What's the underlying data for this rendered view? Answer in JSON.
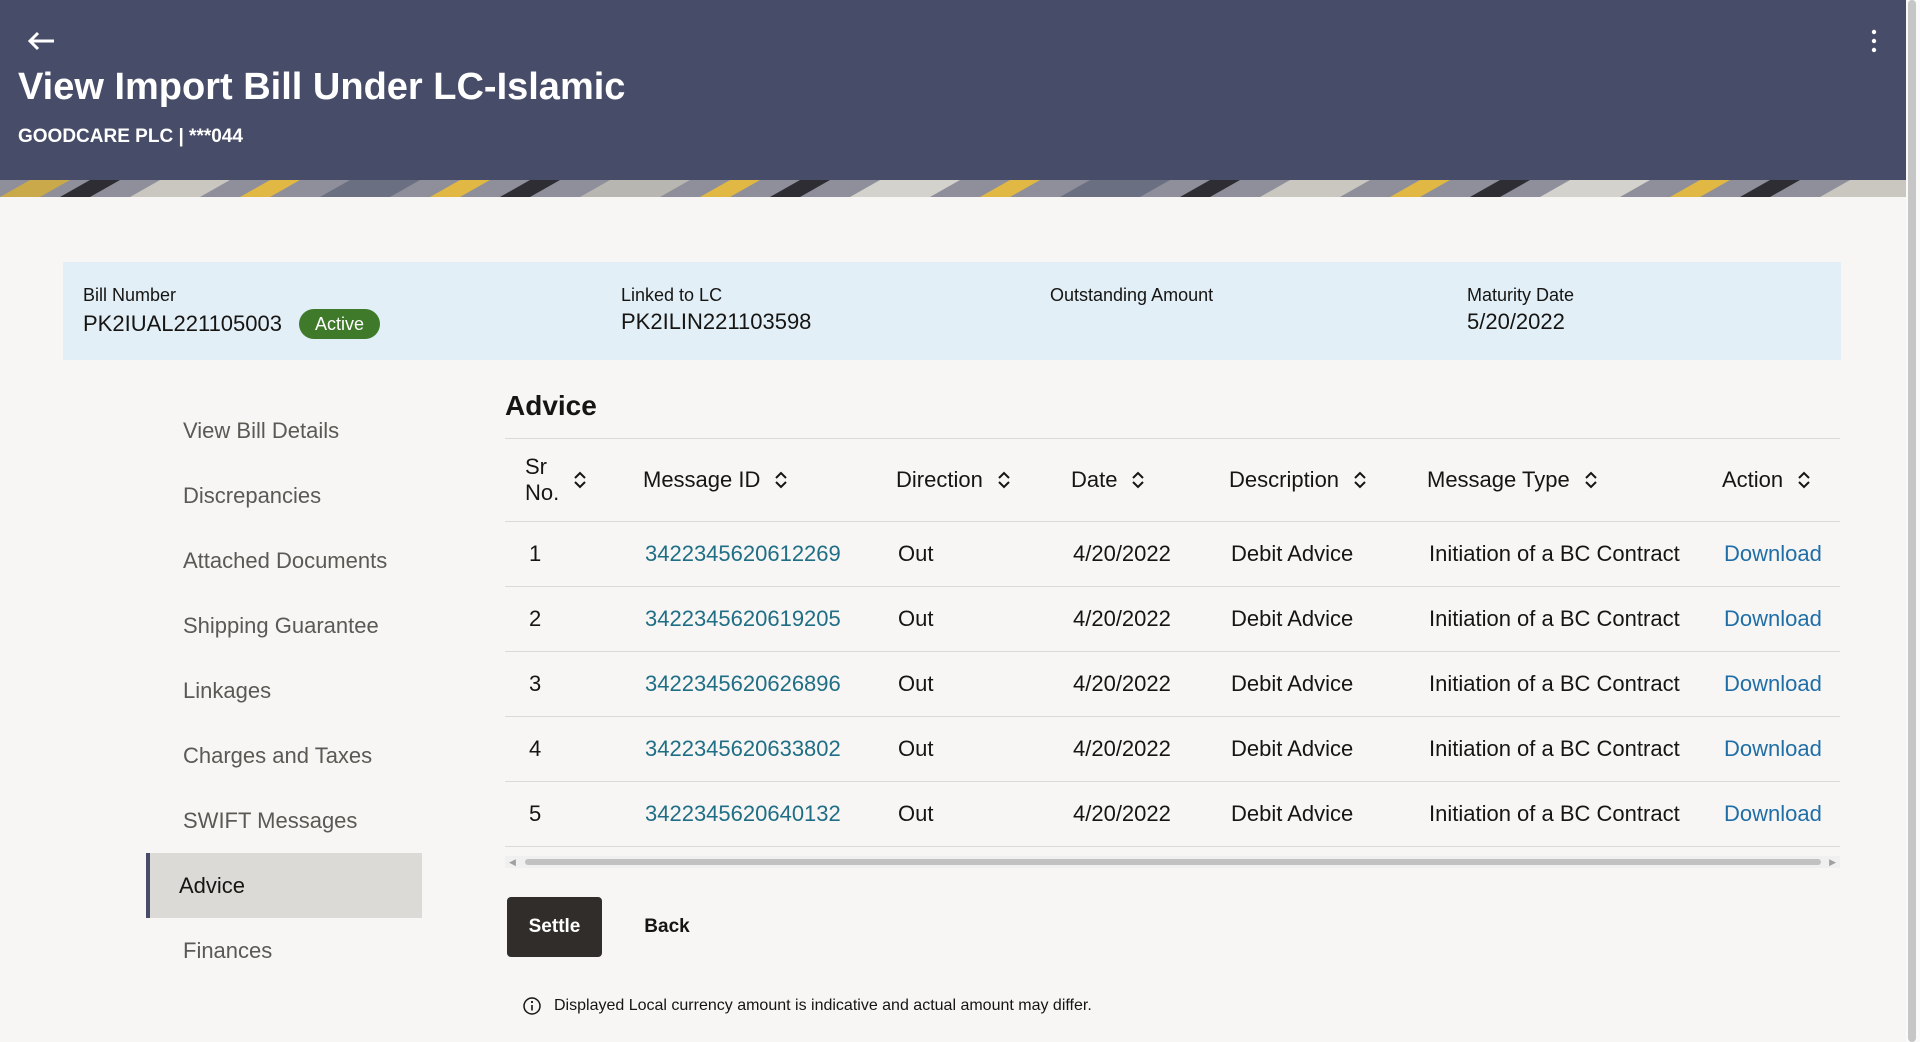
{
  "header": {
    "title": "View Import Bill Under LC-Islamic",
    "subtitle": "GOODCARE PLC | ***044"
  },
  "summary": {
    "bill_number_label": "Bill Number",
    "bill_number": "PK2IUAL221105003",
    "status": "Active",
    "linked_label": "Linked to LC",
    "linked_value": "PK2ILIN221103598",
    "outstanding_label": "Outstanding Amount",
    "outstanding_value": "",
    "maturity_label": "Maturity Date",
    "maturity_value": "5/20/2022"
  },
  "sidebar": {
    "items": [
      {
        "label": "View Bill Details",
        "active": false
      },
      {
        "label": "Discrepancies",
        "active": false
      },
      {
        "label": "Attached Documents",
        "active": false
      },
      {
        "label": "Shipping Guarantee",
        "active": false
      },
      {
        "label": "Linkages",
        "active": false
      },
      {
        "label": "Charges and Taxes",
        "active": false
      },
      {
        "label": "SWIFT Messages",
        "active": false
      },
      {
        "label": "Advice",
        "active": true
      },
      {
        "label": "Finances",
        "active": false
      }
    ]
  },
  "section": {
    "title": "Advice"
  },
  "table": {
    "columns": {
      "sr_line1": "Sr",
      "sr_line2": "No.",
      "message_id": "Message ID",
      "direction": "Direction",
      "date": "Date",
      "description": "Description",
      "message_type": "Message Type",
      "action": "Action"
    },
    "rows": [
      {
        "sr": "1",
        "message_id": "3422345620612269",
        "direction": "Out",
        "date": "4/20/2022",
        "description": "Debit Advice",
        "message_type": "Initiation of a BC Contract",
        "action": "Download"
      },
      {
        "sr": "2",
        "message_id": "3422345620619205",
        "direction": "Out",
        "date": "4/20/2022",
        "description": "Debit Advice",
        "message_type": "Initiation of a BC Contract",
        "action": "Download"
      },
      {
        "sr": "3",
        "message_id": "3422345620626896",
        "direction": "Out",
        "date": "4/20/2022",
        "description": "Debit Advice",
        "message_type": "Initiation of a BC Contract",
        "action": "Download"
      },
      {
        "sr": "4",
        "message_id": "3422345620633802",
        "direction": "Out",
        "date": "4/20/2022",
        "description": "Debit Advice",
        "message_type": "Initiation of a BC Contract",
        "action": "Download"
      },
      {
        "sr": "5",
        "message_id": "3422345620640132",
        "direction": "Out",
        "date": "4/20/2022",
        "description": "Debit Advice",
        "message_type": "Initiation of a BC Contract",
        "action": "Download"
      }
    ]
  },
  "buttons": {
    "settle": "Settle",
    "back": "Back"
  },
  "note": "Displayed Local currency amount is indicative and actual amount may differ.",
  "icons": [
    "back-arrow-icon",
    "more-vertical-icon",
    "sort-icon",
    "info-icon"
  ],
  "colors": {
    "header_bg": "#474c68",
    "summary_bg": "#e2eff6",
    "badge_bg": "#3f7a2b",
    "link": "#1f6e85",
    "button_bg": "#312d2a"
  }
}
